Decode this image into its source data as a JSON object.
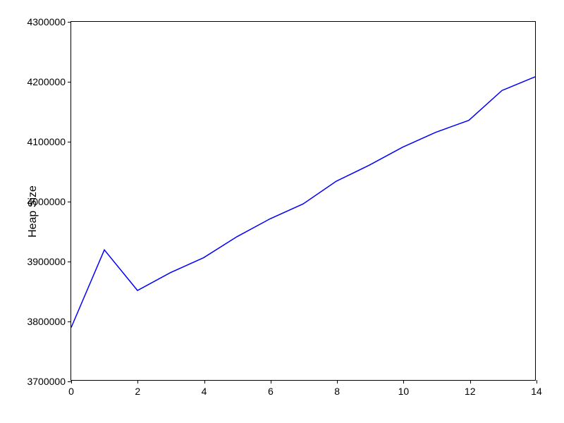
{
  "chart_data": {
    "type": "line",
    "x": [
      0,
      1,
      2,
      3,
      4,
      5,
      6,
      7,
      8,
      9,
      10,
      11,
      12,
      13,
      14
    ],
    "values": [
      3788000,
      3918000,
      3850000,
      3880000,
      3905000,
      3940000,
      3970000,
      3995000,
      4033000,
      4060000,
      4090000,
      4115000,
      4135000,
      4185000,
      4208000
    ],
    "ylabel": "Heap Size",
    "xlabel": "",
    "title": "",
    "xlim": [
      0,
      14
    ],
    "ylim": [
      3700000,
      4300000
    ],
    "xticks": [
      0,
      2,
      4,
      6,
      8,
      10,
      12,
      14
    ],
    "yticks": [
      3700000,
      3800000,
      3900000,
      4000000,
      4100000,
      4200000,
      4300000
    ],
    "line_color": "#0000ff"
  }
}
